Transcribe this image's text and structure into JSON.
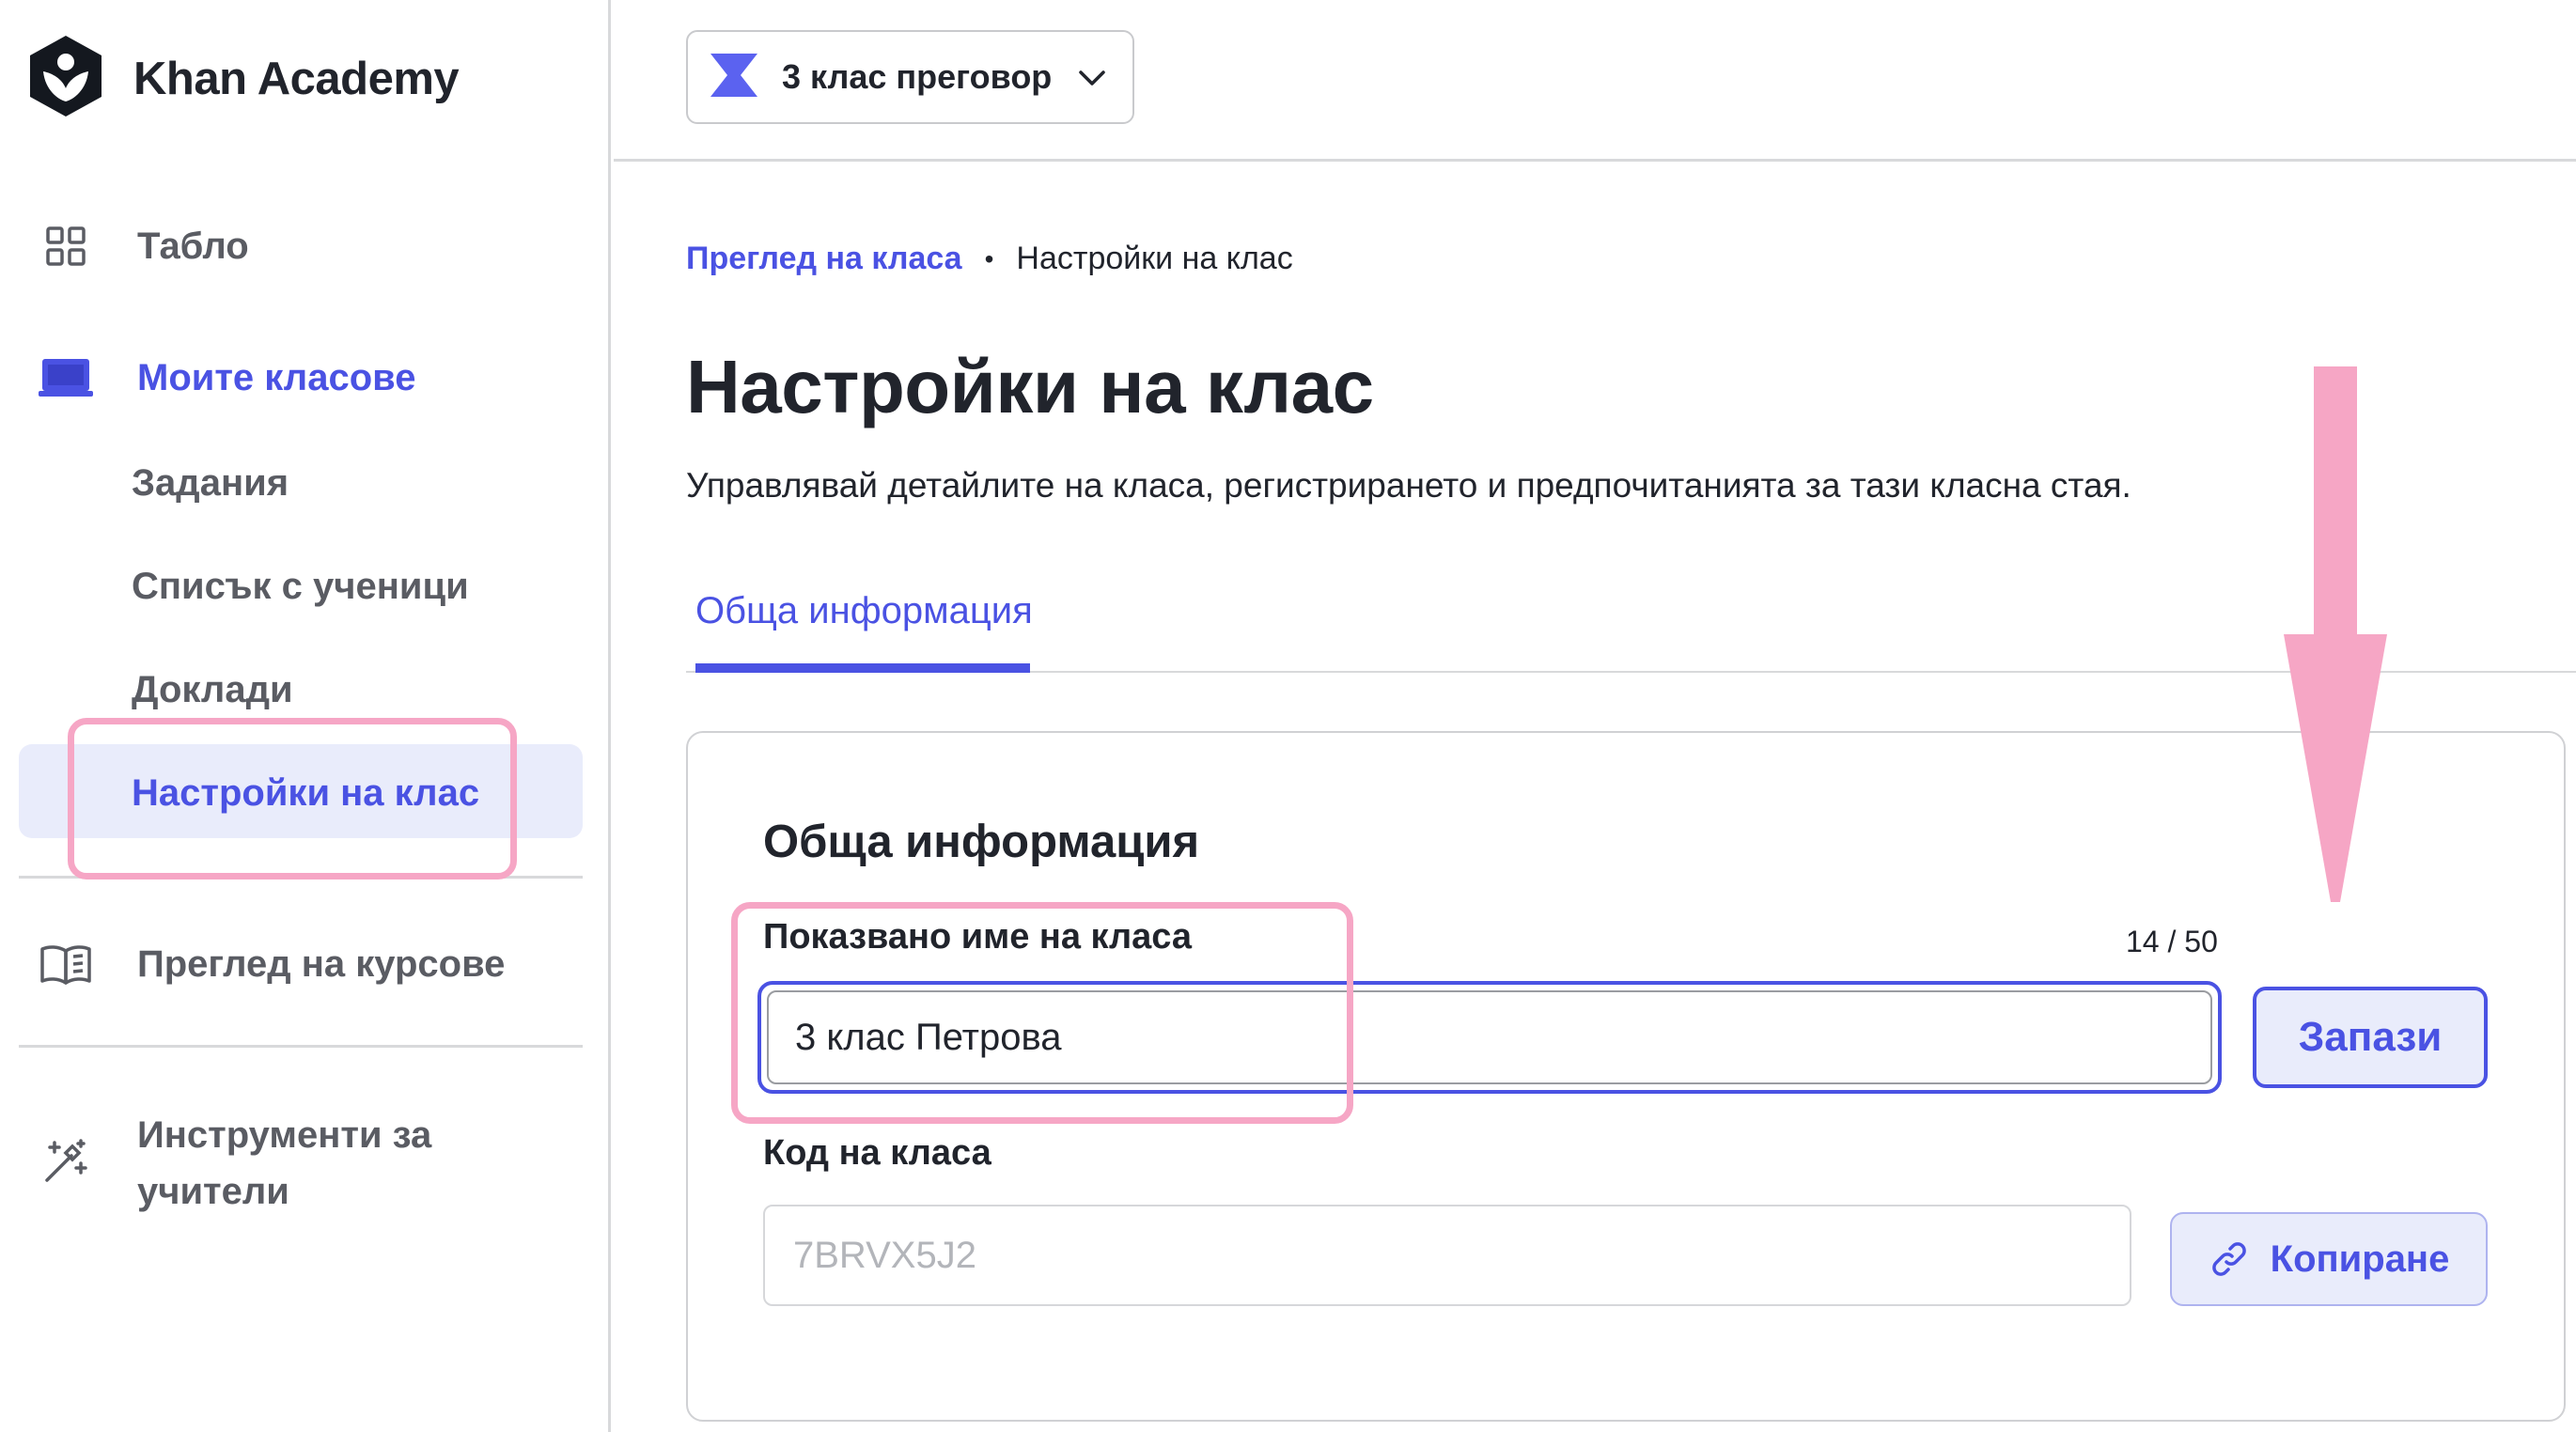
{
  "app": {
    "name": "Khan Academy"
  },
  "sidebar": {
    "dashboard_label": "Табло",
    "my_classes_label": "Моите класове",
    "sub_items": [
      "Задания",
      "Списък с ученици",
      "Доклади",
      "Настройки на клас"
    ],
    "course_review_label": "Преглед на курсове",
    "teacher_tools_label": "Инструменти за учители"
  },
  "header": {
    "class_selector_value": "3 клас преговор"
  },
  "breadcrumb": {
    "link": "Преглед на класа",
    "separator": "•",
    "current": "Настройки на клас"
  },
  "main": {
    "title": "Настройки на клас",
    "subtitle": "Управлявай детайлите на класа, регистрирането и предпочитанията за тази класна стая.",
    "tabs": [
      {
        "label": "Обща информация"
      }
    ],
    "card": {
      "title": "Обща информация",
      "display_name_label": "Показвано име на класа",
      "display_name_value": "3 клас Петрова",
      "counter": "14 / 50",
      "save_label": "Запази",
      "class_code_label": "Код на класа",
      "class_code_value": "7BRVX5J2",
      "copy_label": "Копиране"
    }
  },
  "colors": {
    "accent": "#4a52e3",
    "accent_light": "#e9ecfb",
    "highlight_pink": "#f6a6c5",
    "text": "#21242c",
    "muted_text": "#5a5c63",
    "border": "#d8d9db"
  },
  "icons": {
    "logo": "khan-academy-logo-icon",
    "dashboard": "grid-icon",
    "classes": "classroom-board-icon",
    "courses": "open-book-icon",
    "tools": "magic-wand-icon",
    "class_selector": "hourglass-icon",
    "dropdown": "chevron-down-icon",
    "copy": "link-icon",
    "annotation": "down-arrow-annotation"
  }
}
